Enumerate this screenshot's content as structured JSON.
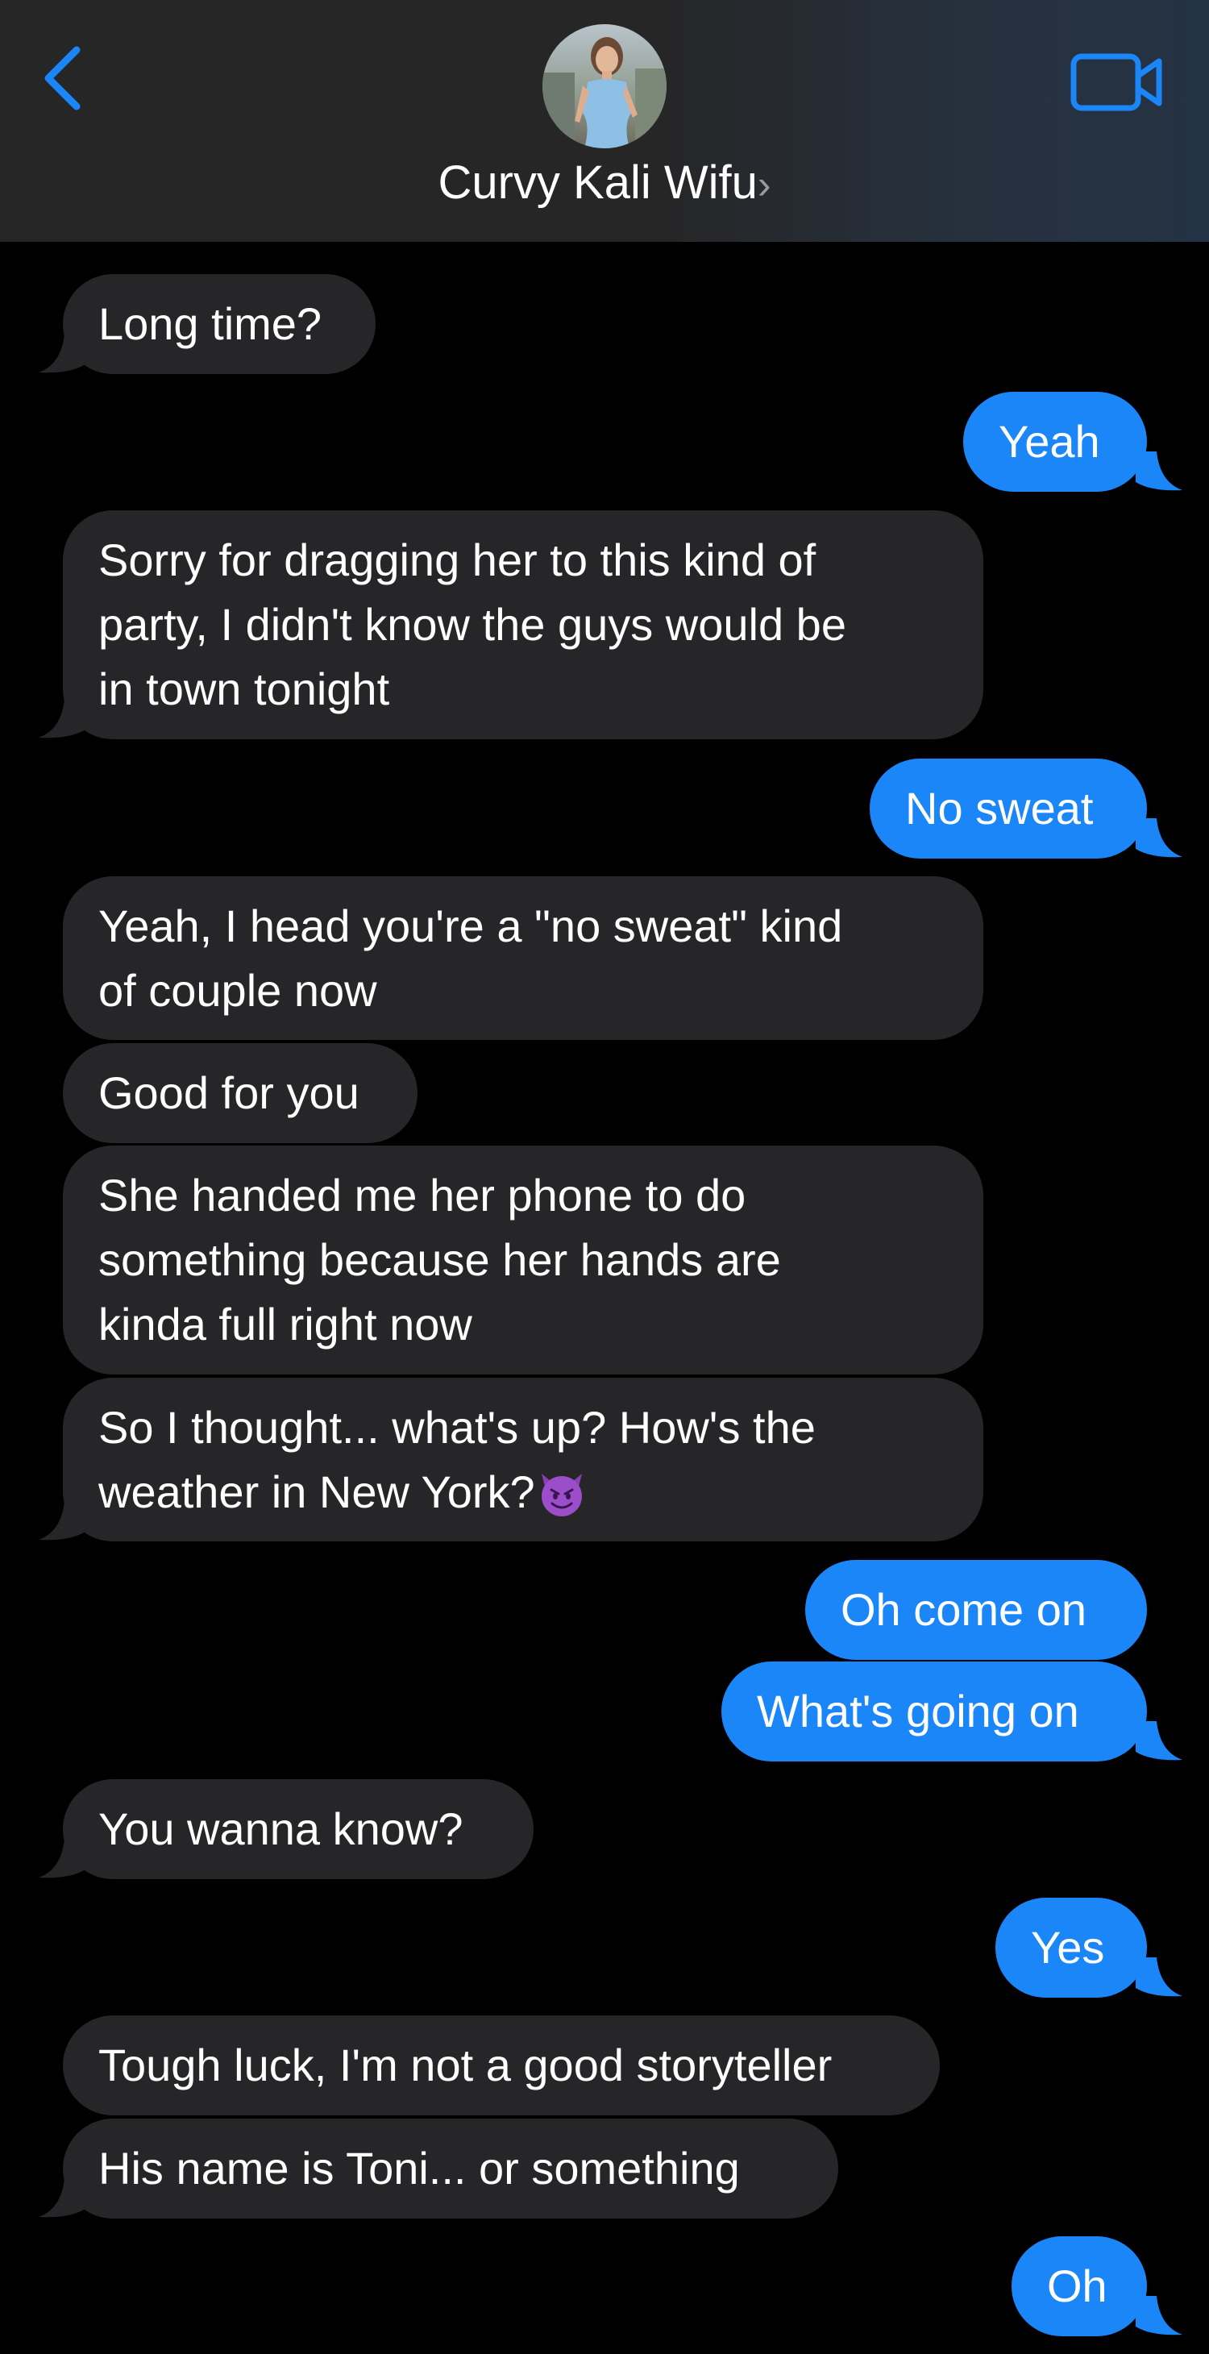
{
  "header": {
    "contact_name": "Curvy Kali Wifu",
    "chevron": "›",
    "back_icon": "chevron-left-icon",
    "video_icon": "video-camera-icon",
    "accent_color": "#1a86f8"
  },
  "colors": {
    "incoming_bubble": "#262629",
    "outgoing_bubble": "#1a86f8",
    "background": "#000000"
  },
  "messages": [
    {
      "dir": "in",
      "lines": [
        "Long time?"
      ]
    },
    {
      "dir": "out",
      "lines": [
        "Yeah"
      ]
    },
    {
      "dir": "in",
      "lines": [
        "Sorry for dragging her to this kind of",
        "party, I didn't know the guys would be",
        "in town tonight"
      ]
    },
    {
      "dir": "out",
      "lines": [
        "No sweat"
      ]
    },
    {
      "dir": "in",
      "lines": [
        "Yeah, I head you're a \"no sweat\" kind",
        "of couple now"
      ]
    },
    {
      "dir": "in",
      "lines": [
        "Good for you"
      ]
    },
    {
      "dir": "in",
      "lines": [
        "She handed me her phone to do",
        "something because her hands are",
        "kinda full right now"
      ]
    },
    {
      "dir": "in",
      "lines": [
        "So I thought... what's up? How's the",
        "weather in New York?"
      ],
      "emoji": "smiling-devil-emoji"
    },
    {
      "dir": "out",
      "lines": [
        "Oh come on"
      ]
    },
    {
      "dir": "out",
      "lines": [
        "What's going on"
      ]
    },
    {
      "dir": "in",
      "lines": [
        "You wanna know?"
      ]
    },
    {
      "dir": "out",
      "lines": [
        "Yes"
      ]
    },
    {
      "dir": "in",
      "lines": [
        "Tough luck, I'm not a good storyteller"
      ]
    },
    {
      "dir": "in",
      "lines": [
        "His name is Toni... or something"
      ]
    },
    {
      "dir": "out",
      "lines": [
        "Oh"
      ]
    }
  ]
}
